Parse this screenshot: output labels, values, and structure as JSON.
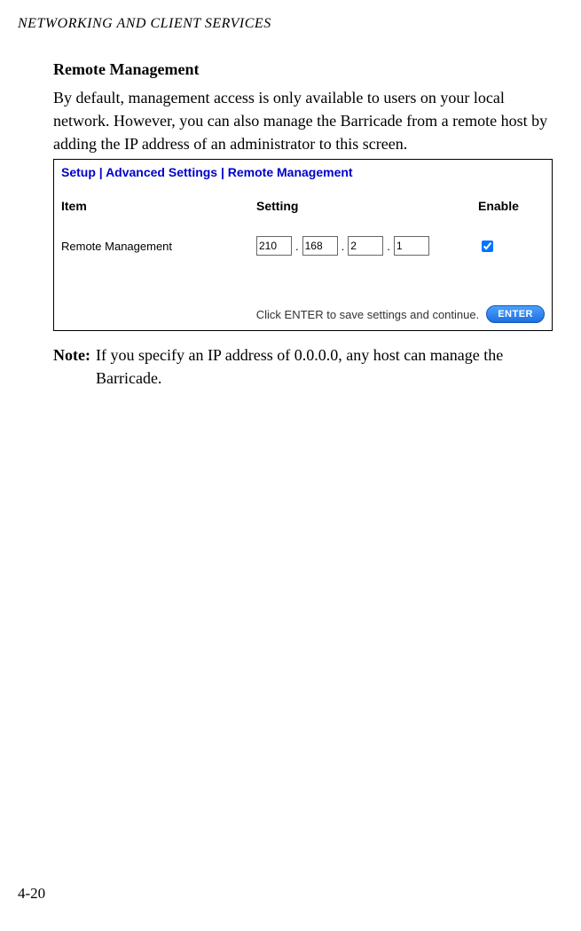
{
  "page_header": "NETWORKING AND CLIENT SERVICES",
  "section_title": "Remote Management",
  "body_para": "By default, management access is only available to users on your local network. However, you can also manage the Barricade from a remote host by adding the IP address of an administrator to this screen.",
  "screenshot": {
    "breadcrumb": "Setup | Advanced Settings | Remote Management",
    "headers": {
      "item": "Item",
      "setting": "Setting",
      "enable": "Enable"
    },
    "row_label": "Remote Management",
    "ip": {
      "a": "210",
      "b": "168",
      "c": "2",
      "d": "1"
    },
    "enable_checked": true,
    "footer_text": "Click ENTER to save settings and continue.",
    "enter_label": "ENTER"
  },
  "note_label": "Note:",
  "note_text": "If you specify an IP address of 0.0.0.0, any host can manage the Barricade.",
  "page_number": "4-20"
}
